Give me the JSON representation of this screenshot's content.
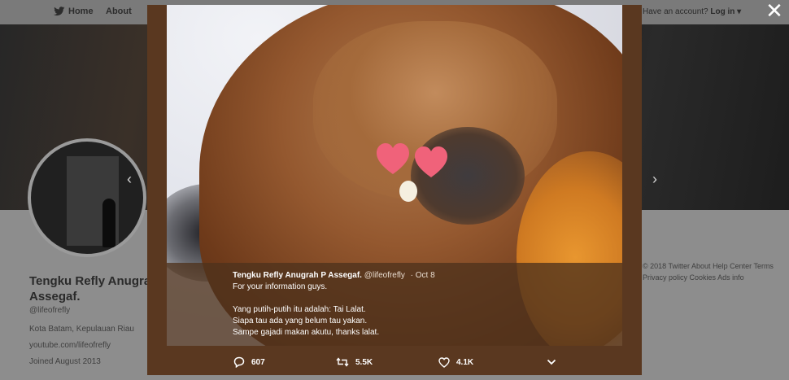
{
  "background": {
    "nav": {
      "home": "Home",
      "about": "About"
    },
    "login": {
      "prompt": "Have an account?",
      "label": "Log in ▾"
    },
    "profile": {
      "name_line1": "Tengku Refly Anugrah",
      "name_line2": "Assegaf.",
      "handle": "@lifeofrefly",
      "location": "Kota Batam, Kepulauan Riau",
      "link": "youtube.com/lifeofrefly",
      "joined": "Joined August 2013"
    },
    "footer_links": [
      "© 2018 Twitter",
      "About",
      "Help Center",
      "Terms",
      "Privacy policy",
      "Cookies",
      "Ads info"
    ]
  },
  "modal": {
    "close_label": "✕",
    "tweet": {
      "author": "Tengku Refly Anugrah P Assegaf.",
      "handle": "@lifeofrefly",
      "separator": "·",
      "date": "Oct 8",
      "lines": [
        "For your information guys.",
        "",
        "Yang putih-putih itu adalah: Tai Lalat.",
        "Siapa tau ada yang belum tau yakan.",
        "Sampe gajadi makan akutu, thanks lalat."
      ]
    },
    "actions": {
      "replies": "607",
      "retweets": "5.5K",
      "likes": "4.1K"
    },
    "icons": {
      "reply": "reply-icon",
      "retweet": "retweet-icon",
      "like": "heart-icon",
      "more": "chevron-down-icon",
      "close": "close-icon",
      "sticker": "heart-sticker-icon"
    },
    "colors": {
      "overlay_bg": "#5a3820",
      "sticker": "#f0627a",
      "text": "#ffffff"
    }
  }
}
